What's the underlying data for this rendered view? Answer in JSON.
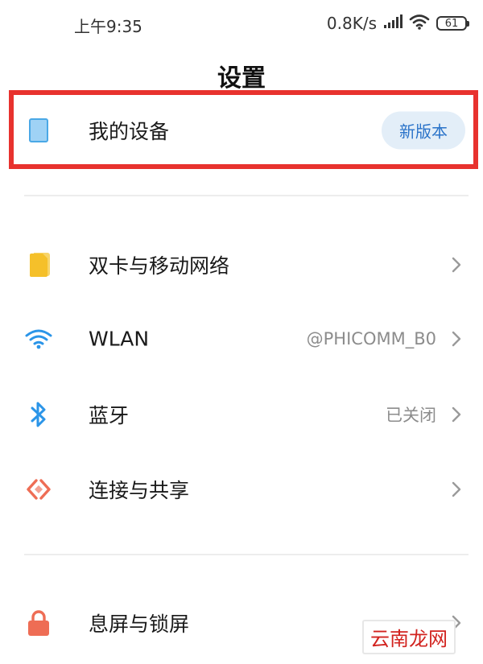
{
  "status_bar": {
    "time": "上午9:35",
    "network_speed": "0.8K/s",
    "battery_level": "61",
    "signal_icon": "cellular-signal-icon",
    "wifi_icon": "wifi-icon"
  },
  "page": {
    "title": "设置"
  },
  "device_row": {
    "label": "我的设备",
    "badge": "新版本",
    "icon": "tablet-icon",
    "highlight_color": "#e8322e"
  },
  "settings": {
    "items": [
      {
        "label": "双卡与移动网络",
        "value": "",
        "icon": "sim-card-icon",
        "color": "#f5c02a"
      },
      {
        "label": "WLAN",
        "value": "@PHICOMM_B0",
        "icon": "wifi-icon",
        "color": "#2b95e8"
      },
      {
        "label": "蓝牙",
        "value": "已关闭",
        "icon": "bluetooth-icon",
        "color": "#2b95e8"
      },
      {
        "label": "连接与共享",
        "value": "",
        "icon": "share-icon",
        "color": "#ee6d55"
      },
      {
        "label": "息屏与锁屏",
        "value": "",
        "icon": "lock-icon",
        "color": "#ee6d55"
      }
    ]
  },
  "watermark": {
    "text": "云南龙网"
  }
}
